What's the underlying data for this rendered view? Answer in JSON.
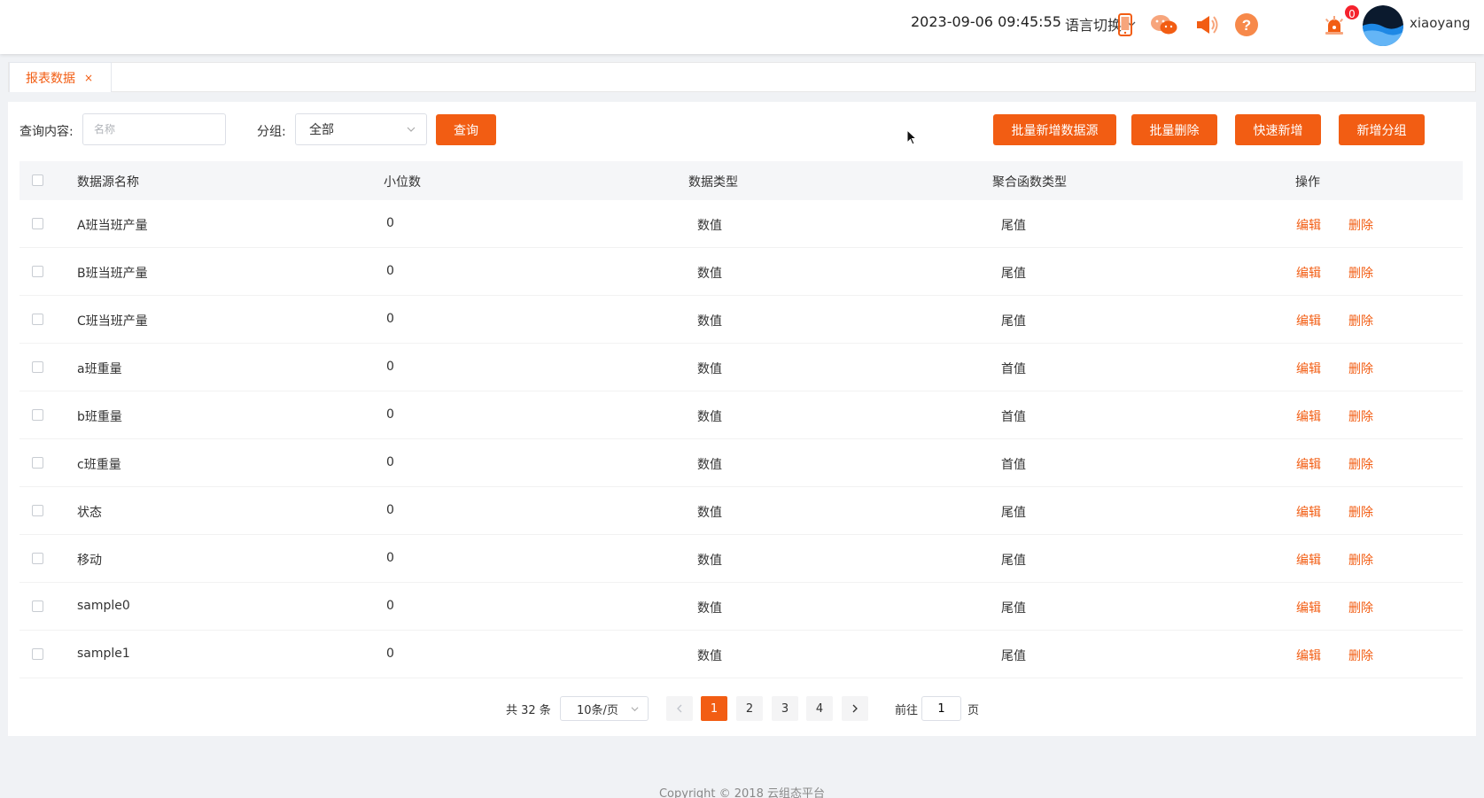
{
  "header": {
    "datetime": "2023-09-06 09:45:55",
    "language_label": "语言切换",
    "icons": [
      "mobile-icon",
      "wechat-icon",
      "speaker-icon",
      "help-icon",
      "alarm-icon"
    ],
    "alarm_count": "0",
    "username": "xiaoyang"
  },
  "tabs": [
    {
      "label": "报表数据",
      "close": "×"
    }
  ],
  "filters": {
    "query_label": "查询内容:",
    "query_placeholder": "名称",
    "group_label": "分组:",
    "group_value": "全部",
    "search_button": "查询"
  },
  "actions": {
    "batch_add": "批量新增数据源",
    "batch_delete": "批量删除",
    "quick_add": "快速新增",
    "add_group": "新增分组"
  },
  "table": {
    "columns": [
      "数据源名称",
      "小位数",
      "数据类型",
      "聚合函数类型",
      "操作"
    ],
    "rows": [
      {
        "name": "A班当班产量",
        "decimals": "0",
        "type": "数值",
        "agg": "尾值"
      },
      {
        "name": "B班当班产量",
        "decimals": "0",
        "type": "数值",
        "agg": "尾值"
      },
      {
        "name": "C班当班产量",
        "decimals": "0",
        "type": "数值",
        "agg": "尾值"
      },
      {
        "name": "a班重量",
        "decimals": "0",
        "type": "数值",
        "agg": "首值"
      },
      {
        "name": "b班重量",
        "decimals": "0",
        "type": "数值",
        "agg": "首值"
      },
      {
        "name": "c班重量",
        "decimals": "0",
        "type": "数值",
        "agg": "首值"
      },
      {
        "name": "状态",
        "decimals": "0",
        "type": "数值",
        "agg": "尾值"
      },
      {
        "name": "移动",
        "decimals": "0",
        "type": "数值",
        "agg": "尾值"
      },
      {
        "name": "sample0",
        "decimals": "0",
        "type": "数值",
        "agg": "尾值"
      },
      {
        "name": "sample1",
        "decimals": "0",
        "type": "数值",
        "agg": "尾值"
      }
    ],
    "edit_label": "编辑",
    "delete_label": "删除"
  },
  "pagination": {
    "total": "共 32 条",
    "page_size": "10条/页",
    "pages": [
      "1",
      "2",
      "3",
      "4"
    ],
    "current": "1",
    "goto_label": "前往",
    "goto_value": "1",
    "page_suffix": "页"
  },
  "footer": {
    "copyright": "Copyright © 2018 云组态平台"
  },
  "colors": {
    "accent": "#f25d13",
    "badge": "#f5222d"
  }
}
